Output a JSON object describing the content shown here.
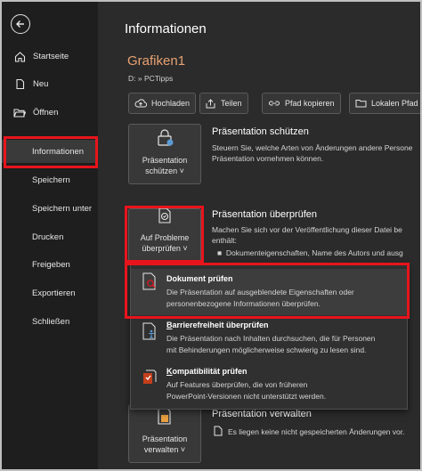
{
  "sidebar": {
    "items": [
      {
        "label": "Startseite"
      },
      {
        "label": "Neu"
      },
      {
        "label": "Öffnen"
      },
      {
        "label": "Informationen"
      },
      {
        "label": "Speichern"
      },
      {
        "label": "Speichern unter"
      },
      {
        "label": "Drucken"
      },
      {
        "label": "Freigeben"
      },
      {
        "label": "Exportieren"
      },
      {
        "label": "Schließen"
      }
    ]
  },
  "main": {
    "title": "Informationen",
    "file_name": "Grafiken1",
    "file_path": "D: » PCTipps",
    "toolbar": {
      "upload": "Hochladen",
      "share": "Teilen",
      "copy_path": "Pfad kopieren",
      "local_path": "Lokalen Pfad ko"
    },
    "protect": {
      "button_line1": "Präsentation",
      "button_line2": "schützen ˅",
      "title": "Präsentation schützen",
      "desc_line1": "Steuern Sie, welche Arten von Änderungen andere Persone",
      "desc_line2": "Präsentation vornehmen können."
    },
    "inspect": {
      "button_line1": "Auf Probleme",
      "button_line2": "überprüfen ˅",
      "title": "Präsentation überprüfen",
      "desc_line1": "Machen Sie sich vor der Veröffentlichung dieser Datei be",
      "desc_line2": "enthält:",
      "bullet1": "Dokumenteigenschaften, Name des Autors und ausg"
    },
    "manage": {
      "button_line1": "Präsentation",
      "button_line2": "verwalten ˅",
      "title": "Präsentation verwalten",
      "desc": "Es liegen keine nicht gespeicherten Änderungen vor."
    }
  },
  "dropdown": {
    "items": [
      {
        "title": "Dokument prüfen",
        "desc1": "Die Präsentation auf ausgeblendete Eigenschaften oder",
        "desc2": "personenbezogene Informationen überprüfen."
      },
      {
        "title": "Barrierefreiheit überprüfen",
        "desc1": "Die Präsentation nach Inhalten durchsuchen, die für Personen",
        "desc2": "mit Behinderungen möglicherweise schwierig zu lesen sind."
      },
      {
        "title": "Kompatibilität prüfen",
        "desc1": "Auf Features überprüfen, die von früheren",
        "desc2": "PowerPoint-Versionen nicht unterstützt werden."
      }
    ]
  },
  "colors": {
    "highlight": "#e8141c",
    "file_name": "#e8a273",
    "sidebar_bg": "#1e1e1e",
    "main_bg": "#2b2b2b"
  }
}
